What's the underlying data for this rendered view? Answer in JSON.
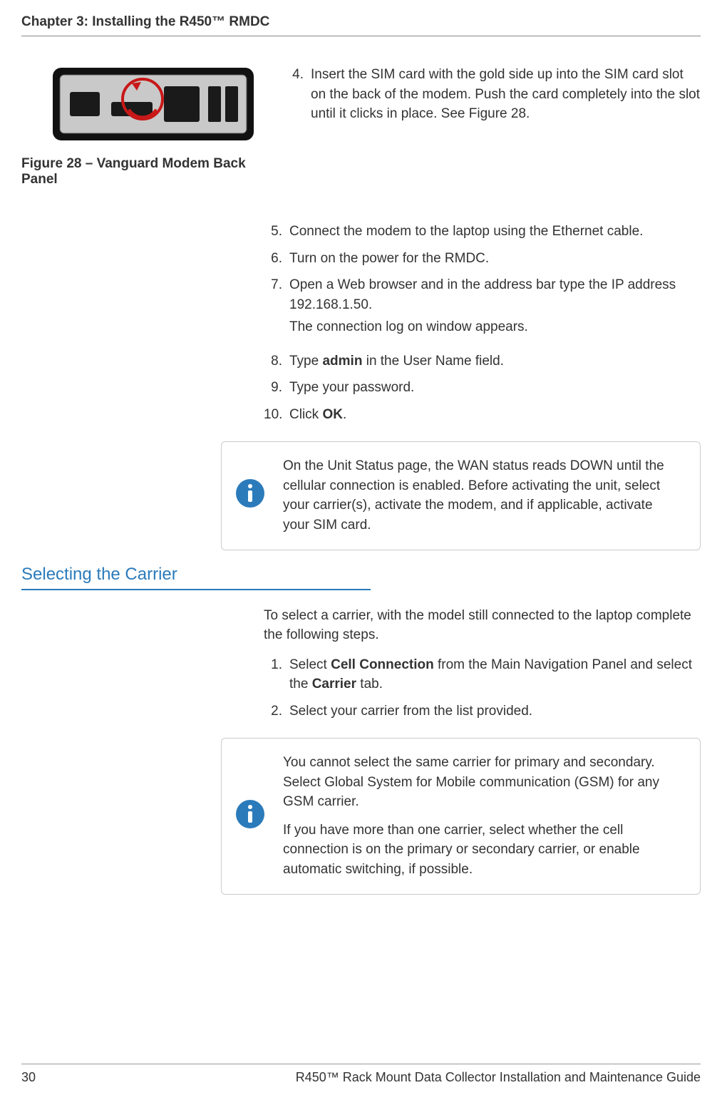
{
  "header": "Chapter 3: Installing the R450™ RMDC",
  "figure": {
    "caption": "Figure 28  –  Vanguard Modem Back Panel"
  },
  "steps_a": [
    {
      "n": "4.",
      "text": "Insert the SIM card with the gold side up into the SIM card slot on the back of the modem. Push the card completely into the slot until it clicks in place. See Figure 28."
    }
  ],
  "steps_b": [
    {
      "n": "5.",
      "text": "Connect the modem to the laptop using the Ethernet cable."
    },
    {
      "n": "6.",
      "text": "Turn on the power for the RMDC."
    },
    {
      "n": "7.",
      "text": "Open a Web browser and in the address bar type the IP address 192.168.1.50.",
      "sub": "The connection log on window appears."
    },
    {
      "n": "8.",
      "pre": "Type ",
      "bold": "admin",
      "post": " in the User Name field."
    },
    {
      "n": "9.",
      "text": "Type your password."
    },
    {
      "n": "10.",
      "pre": "Click ",
      "bold": "OK",
      "post": "."
    }
  ],
  "note_1": "On the Unit Status page, the WAN status reads DOWN until the cellular connection is enabled. Before activating the unit, select your carrier(s), activate the modem, and if applicable, activate your SIM card.",
  "section_heading": "Selecting the Carrier",
  "section_intro": "To select a carrier, with the model still connected to the laptop complete the following steps.",
  "steps_c": [
    {
      "n": "1.",
      "pre": "Select ",
      "bold": "Cell Connection",
      "mid": " from the Main Navigation Panel and select the ",
      "bold2": "Carrier",
      "post": " tab."
    },
    {
      "n": "2.",
      "text": "Select your carrier from the list provided."
    }
  ],
  "note_2a": "You cannot select the same carrier for primary and secondary. Select Global System for Mobile communication (GSM) for any GSM carrier.",
  "note_2b": "If you have more than one carrier, select whether the cell connection is on the primary or secondary carrier, or enable automatic switching, if possible.",
  "footer": {
    "page": "30",
    "title": "R450™ Rack Mount Data Collector Installation and Maintenance Guide"
  }
}
